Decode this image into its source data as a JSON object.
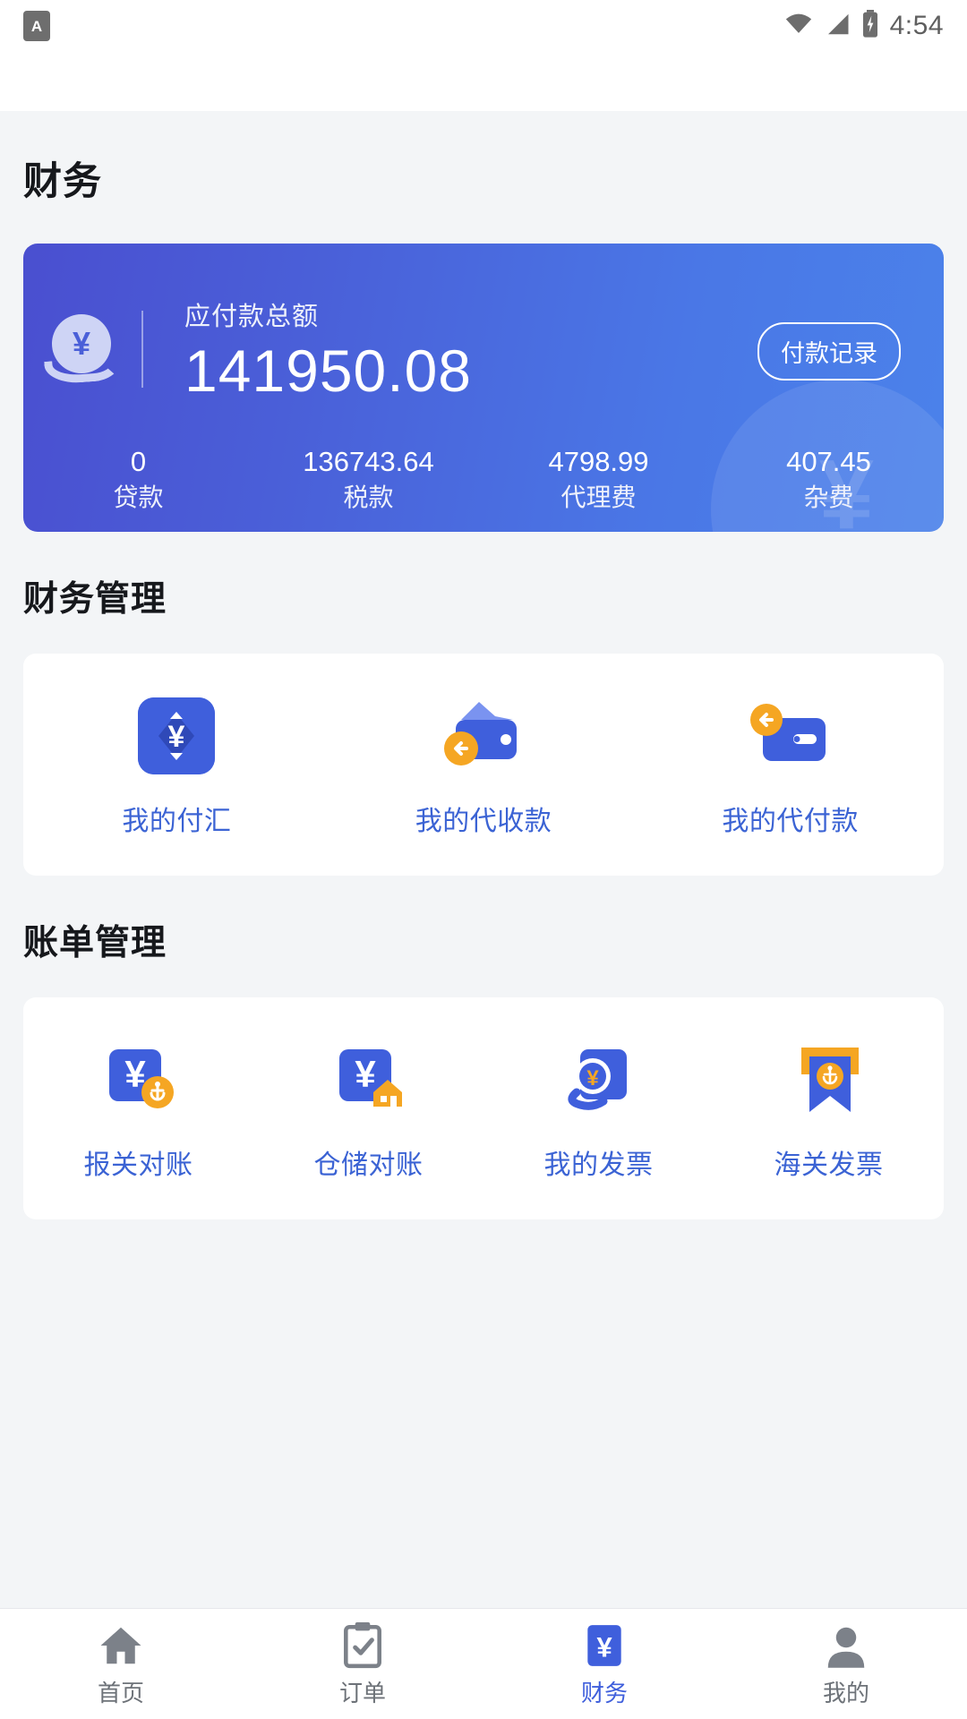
{
  "status_bar": {
    "app_badge": "A",
    "time": "4:54",
    "icons": [
      "wifi-icon",
      "cellular-signal-icon",
      "battery-charging-icon"
    ]
  },
  "page_title": "财务",
  "summary_card": {
    "icon": "hand-holding-yen-coin-icon",
    "coin_symbol": "¥",
    "label": "应付款总额",
    "amount": "141950.08",
    "record_button": "付款记录",
    "watermark_symbol": "¥",
    "stats": [
      {
        "value": "0",
        "key": "贷款"
      },
      {
        "value": "136743.64",
        "key": "税款"
      },
      {
        "value": "4798.99",
        "key": "代理费"
      },
      {
        "value": "407.45",
        "key": "杂费"
      }
    ]
  },
  "finance_section": {
    "title": "财务管理",
    "tiles": [
      {
        "label": "我的付汇",
        "icon": "exchange-payment-icon"
      },
      {
        "label": "我的代收款",
        "icon": "wallet-incoming-icon"
      },
      {
        "label": "我的代付款",
        "icon": "wallet-outgoing-icon"
      }
    ]
  },
  "bill_section": {
    "title": "账单管理",
    "tiles": [
      {
        "label": "报关对账",
        "icon": "customs-reconcile-icon"
      },
      {
        "label": "仓储对账",
        "icon": "warehouse-reconcile-icon"
      },
      {
        "label": "我的发票",
        "icon": "my-invoice-icon"
      },
      {
        "label": "海关发票",
        "icon": "customs-invoice-icon"
      }
    ]
  },
  "tabbar": {
    "tabs": [
      {
        "label": "首页",
        "icon": "home-icon",
        "active": false
      },
      {
        "label": "订单",
        "icon": "clipboard-check-icon",
        "active": false
      },
      {
        "label": "财务",
        "icon": "finance-yen-icon",
        "active": true
      },
      {
        "label": "我的",
        "icon": "user-profile-icon",
        "active": false
      }
    ]
  },
  "colors": {
    "brand_blue": "#3f5fdc",
    "accent_orange": "#f5a623",
    "page_bg": "#f3f5f7",
    "card_gradient_from": "#4a4fd0",
    "card_gradient_to": "#4b82ea",
    "label_blue": "#3b63d4"
  }
}
